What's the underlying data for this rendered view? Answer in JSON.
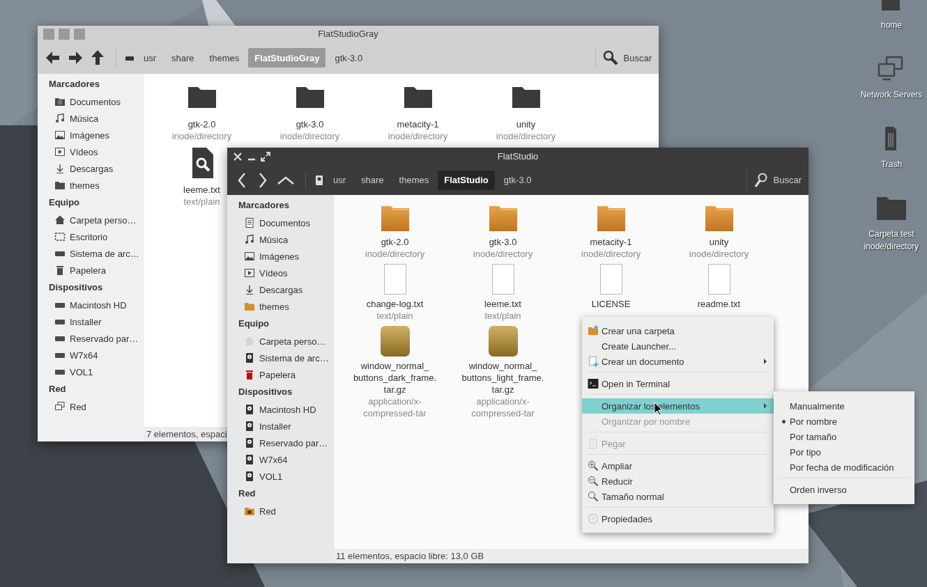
{
  "windows": [
    {
      "title": "FlatStudioGray",
      "path": [
        {
          "label": "usr",
          "selected": false
        },
        {
          "label": "share",
          "selected": false
        },
        {
          "label": "themes",
          "selected": false
        },
        {
          "label": "FlatStudioGray",
          "selected": true
        },
        {
          "label": "gtk-3.0",
          "selected": false
        }
      ],
      "search": "Buscar",
      "sidebar": [
        {
          "heading": "Marcadores",
          "items": [
            {
              "label": "Documentos",
              "kind": "documents"
            },
            {
              "label": "Música",
              "kind": "music"
            },
            {
              "label": "Imágenes",
              "kind": "images"
            },
            {
              "label": "Vídeos",
              "kind": "videos"
            },
            {
              "label": "Descargas",
              "kind": "downloads"
            },
            {
              "label": "themes",
              "kind": "folder"
            }
          ]
        },
        {
          "heading": "Equipo",
          "items": [
            {
              "label": "Carpeta perso…",
              "kind": "home"
            },
            {
              "label": "Escritorio",
              "kind": "desktop"
            },
            {
              "label": "Sistema de arc…",
              "kind": "drive"
            },
            {
              "label": "Papelera",
              "kind": "trash"
            }
          ]
        },
        {
          "heading": "Dispositivos",
          "items": [
            {
              "label": "Macintosh HD",
              "kind": "drive"
            },
            {
              "label": "Installer",
              "kind": "drive"
            },
            {
              "label": "Reservado par…",
              "kind": "drive"
            },
            {
              "label": "W7x64",
              "kind": "drive"
            },
            {
              "label": "VOL1",
              "kind": "drive"
            }
          ]
        },
        {
          "heading": "Red",
          "items": [
            {
              "label": "Red",
              "kind": "network"
            }
          ]
        }
      ],
      "files": [
        {
          "name": "gtk-2.0",
          "type": "inode/directory",
          "kind": "folder"
        },
        {
          "name": "gtk-3.0",
          "type": "inode/directory",
          "kind": "folder"
        },
        {
          "name": "metacity-1",
          "type": "inode/directory",
          "kind": "folder"
        },
        {
          "name": "unity",
          "type": "inode/directory",
          "kind": "folder"
        },
        {
          "name": "leeme.txt",
          "type": "text/plain",
          "kind": "preview"
        }
      ],
      "status": "7 elementos, espaci"
    },
    {
      "title": "FlatStudio",
      "path": [
        {
          "label": "usr",
          "selected": false
        },
        {
          "label": "share",
          "selected": false
        },
        {
          "label": "themes",
          "selected": false
        },
        {
          "label": "FlatStudio",
          "selected": true
        },
        {
          "label": "gtk-3.0",
          "selected": false
        }
      ],
      "search": "Buscar",
      "sidebar": [
        {
          "heading": "Marcadores",
          "items": [
            {
              "label": "Documentos",
              "kind": "documents"
            },
            {
              "label": "Música",
              "kind": "music"
            },
            {
              "label": "Imágenes",
              "kind": "images"
            },
            {
              "label": "Vídeos",
              "kind": "videos"
            },
            {
              "label": "Descargas",
              "kind": "downloads"
            },
            {
              "label": "themes",
              "kind": "folder"
            }
          ]
        },
        {
          "heading": "Equipo",
          "items": [
            {
              "label": "Carpeta perso…",
              "kind": "home"
            },
            {
              "label": "Sistema de arc…",
              "kind": "drive"
            },
            {
              "label": "Papelera",
              "kind": "trash"
            }
          ]
        },
        {
          "heading": "Dispositivos",
          "items": [
            {
              "label": "Macintosh HD",
              "kind": "drive"
            },
            {
              "label": "Installer",
              "kind": "drive"
            },
            {
              "label": "Reservado par…",
              "kind": "drive"
            },
            {
              "label": "W7x64",
              "kind": "drive"
            },
            {
              "label": "VOL1",
              "kind": "drive"
            }
          ]
        },
        {
          "heading": "Red",
          "items": [
            {
              "label": "Red",
              "kind": "network"
            }
          ]
        }
      ],
      "files": [
        {
          "name": "gtk-2.0",
          "type": "inode/directory",
          "kind": "folder"
        },
        {
          "name": "gtk-3.0",
          "type": "inode/directory",
          "kind": "folder"
        },
        {
          "name": "metacity-1",
          "type": "inode/directory",
          "kind": "folder"
        },
        {
          "name": "unity",
          "type": "inode/directory",
          "kind": "folder"
        },
        {
          "name": "change-log.txt",
          "type": "text/plain",
          "kind": "text"
        },
        {
          "name": "leeme.txt",
          "type": "text/plain",
          "kind": "text"
        },
        {
          "name": "LICENSE",
          "kind": "text"
        },
        {
          "name": "readme.txt",
          "kind": "text"
        },
        {
          "name": "window_normal_buttons_dark_frame.tar.gz",
          "type": "application/x-compressed-tar",
          "kind": "archive"
        },
        {
          "name": "window_normal_buttons_light_frame.tar.gz",
          "type": "application/x-compressed-tar",
          "kind": "archive"
        }
      ],
      "status": "11 elementos, espacio libre: 13,0 GB"
    }
  ],
  "context_menu": {
    "items": [
      {
        "label": "Crear una carpeta",
        "kind": "newfolder",
        "disabled": false,
        "selected": false,
        "submenu": false,
        "separator_before": false
      },
      {
        "label": "Create Launcher...",
        "kind": "plain",
        "disabled": false,
        "selected": false,
        "submenu": false,
        "separator_before": false
      },
      {
        "label": "Crear un documento",
        "kind": "newdoc",
        "disabled": false,
        "selected": false,
        "submenu": true,
        "separator_before": false
      },
      {
        "label": "Open in Terminal",
        "kind": "terminal",
        "disabled": false,
        "selected": false,
        "submenu": false,
        "separator_before": true
      },
      {
        "label": "Organizar los elementos",
        "kind": "plain",
        "disabled": false,
        "selected": true,
        "submenu": true,
        "separator_before": true
      },
      {
        "label": "Organizar por nombre",
        "kind": "plain",
        "disabled": true,
        "selected": false,
        "submenu": false,
        "separator_before": false
      },
      {
        "label": "Pegar",
        "kind": "paste",
        "disabled": true,
        "selected": false,
        "submenu": false,
        "separator_before": true
      },
      {
        "label": "Ampliar",
        "kind": "zoomin",
        "disabled": false,
        "selected": false,
        "submenu": false,
        "separator_before": true
      },
      {
        "label": "Reducir",
        "kind": "zoomout",
        "disabled": false,
        "selected": false,
        "submenu": false,
        "separator_before": false
      },
      {
        "label": "Tamaño normal",
        "kind": "zoomnormal",
        "disabled": false,
        "selected": false,
        "submenu": false,
        "separator_before": false
      },
      {
        "label": "Propiedades",
        "kind": "properties",
        "disabled": false,
        "selected": false,
        "submenu": false,
        "separator_before": true
      }
    ]
  },
  "submenu": {
    "items": [
      {
        "label": "Manualmente",
        "selected": false,
        "separator_before": false
      },
      {
        "label": "Por nombre",
        "selected": true,
        "separator_before": false
      },
      {
        "label": "Por tamaño",
        "selected": false,
        "separator_before": false
      },
      {
        "label": "Por tipo",
        "selected": false,
        "separator_before": false
      },
      {
        "label": "Por fecha de modificación",
        "selected": false,
        "separator_before": false
      },
      {
        "label": "Orden inverso",
        "selected": false,
        "separator_before": true
      }
    ]
  },
  "desktop_icons": [
    {
      "label": "home",
      "kind": "home"
    },
    {
      "label": "Network Servers",
      "kind": "network"
    },
    {
      "label": "Trash",
      "kind": "trash"
    },
    {
      "label": "Carpeta test",
      "type": "inode/directory",
      "kind": "folder"
    }
  ]
}
